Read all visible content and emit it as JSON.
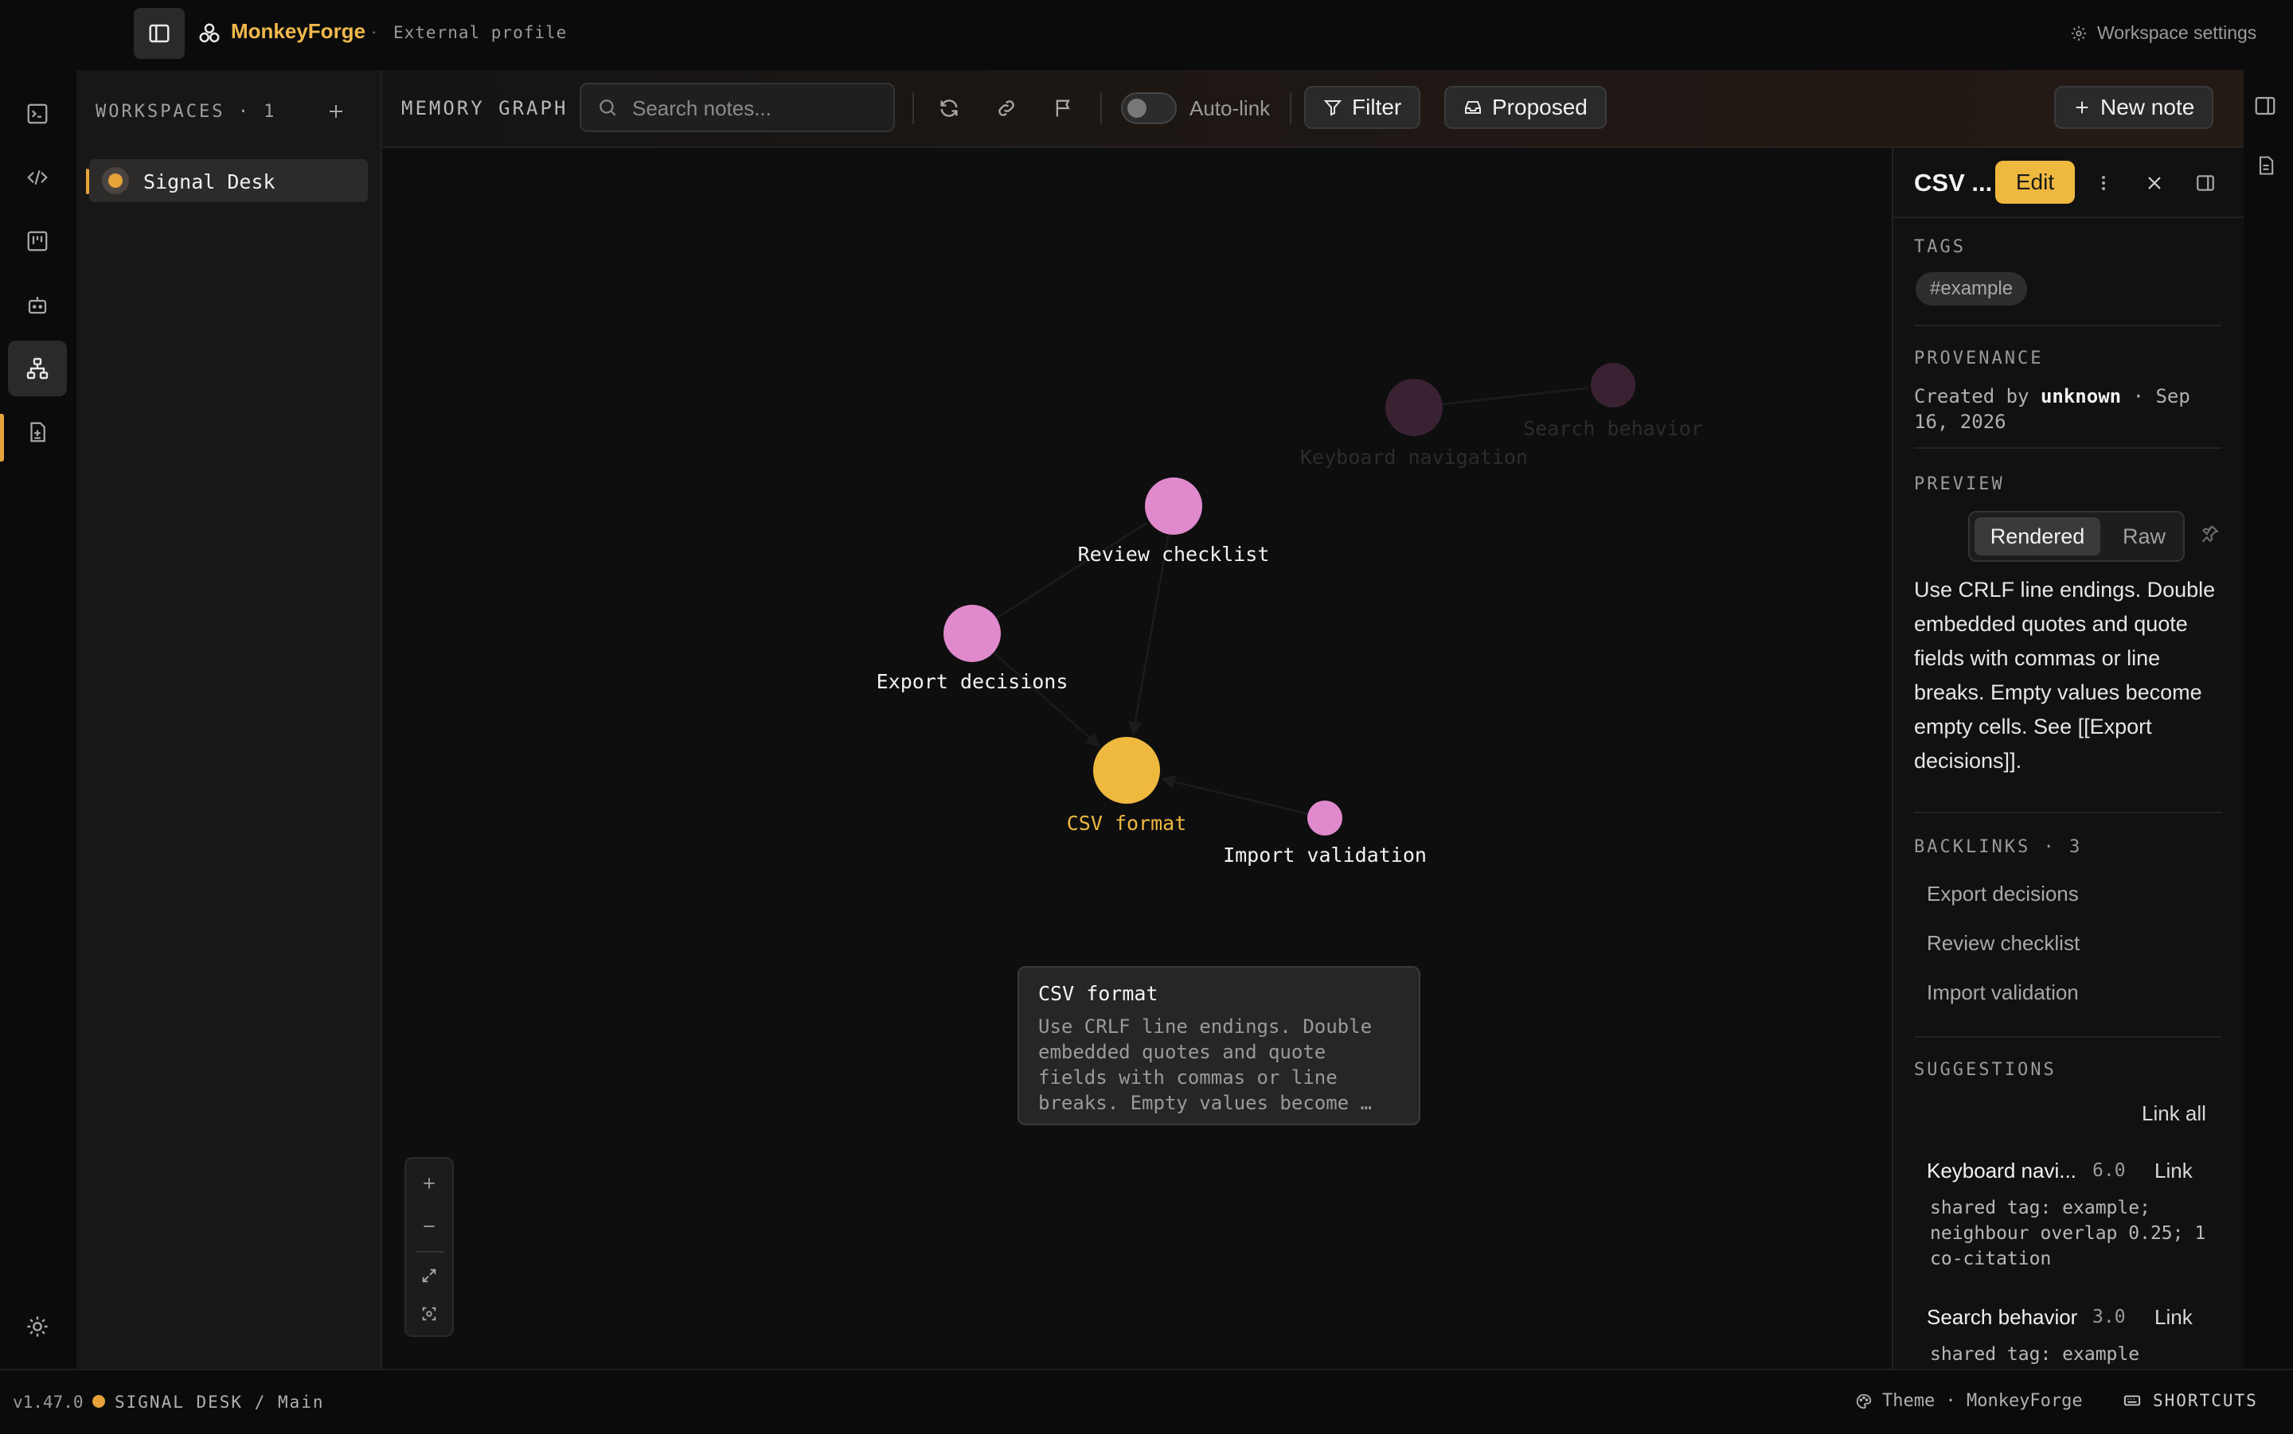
{
  "app": {
    "name": "MonkeyForge",
    "separator": "·",
    "profile": "External profile",
    "workspace_settings": "Workspace settings"
  },
  "workspaces": {
    "title": "WORKSPACES · 1",
    "items": [
      {
        "name": "Signal Desk",
        "color": "#e5a33a"
      }
    ]
  },
  "toolbar": {
    "title": "MEMORY GRAPH",
    "search_placeholder": "Search notes...",
    "autolink_label": "Auto-link",
    "autolink_on": false,
    "filter_label": "Filter",
    "proposed_label": "Proposed",
    "new_note_label": "New note"
  },
  "graph": {
    "nodes": [
      {
        "id": "keyboard",
        "label": "Keyboard navigation",
        "color": "#3a2232",
        "dimmed": true
      },
      {
        "id": "search",
        "label": "Search behavior",
        "color": "#3a2232",
        "dimmed": true
      },
      {
        "id": "review",
        "label": "Review checklist",
        "color": "#e089cc",
        "dimmed": false
      },
      {
        "id": "export",
        "label": "Export decisions",
        "color": "#e089cc",
        "dimmed": false
      },
      {
        "id": "csv",
        "label": "CSV format",
        "color": "#efb83f",
        "dimmed": false,
        "selected": true
      },
      {
        "id": "import",
        "label": "Import validation",
        "color": "#e089cc",
        "dimmed": false
      }
    ],
    "edges": [
      {
        "from": "export",
        "to": "review"
      },
      {
        "from": "review",
        "to": "csv"
      },
      {
        "from": "export",
        "to": "csv"
      },
      {
        "from": "import",
        "to": "csv"
      },
      {
        "from": "keyboard",
        "to": "search"
      }
    ],
    "tooltip": {
      "title": "CSV format",
      "body": "Use CRLF line endings. Double embedded quotes and quote fields with commas or line breaks. Empty values become …"
    },
    "zoom_controls": [
      "zoom-in",
      "zoom-out",
      "fit-view",
      "center-view"
    ]
  },
  "detail": {
    "title": "CSV ...",
    "edit_label": "Edit",
    "tags_heading": "TAGS",
    "tags": [
      "#example"
    ],
    "provenance_heading": "PROVENANCE",
    "provenance_prefix": "Created by",
    "provenance_author": "unknown",
    "provenance_suffix": "· Sep 16, 2026",
    "preview_heading": "PREVIEW",
    "preview_modes": [
      "Rendered",
      "Raw"
    ],
    "preview_text": "Use CRLF line endings. Double embedded quotes and quote fields with commas or line breaks. Empty values become empty cells. See [[Export decisions]].",
    "backlinks_heading": "BACKLINKS · 3",
    "backlinks": [
      "Export decisions",
      "Review checklist",
      "Import validation"
    ],
    "suggestions_heading": "SUGGESTIONS",
    "link_all_label": "Link all",
    "suggestions": [
      {
        "name": "Keyboard navi...",
        "score": "6.0",
        "link": "Link",
        "reason": "shared tag: example; neighbour overlap 0.25; 1 co-citation"
      },
      {
        "name": "Search behavior",
        "score": "3.0",
        "link": "Link",
        "reason": "shared tag: example"
      }
    ]
  },
  "status": {
    "version": "v1.47.0",
    "path": "SIGNAL DESK / Main",
    "theme": "Theme · MonkeyForge",
    "shortcuts": "SHORTCUTS"
  },
  "colors": {
    "accent": "#efb83f",
    "node_pink": "#e089cc",
    "node_dim": "#3a2232"
  }
}
